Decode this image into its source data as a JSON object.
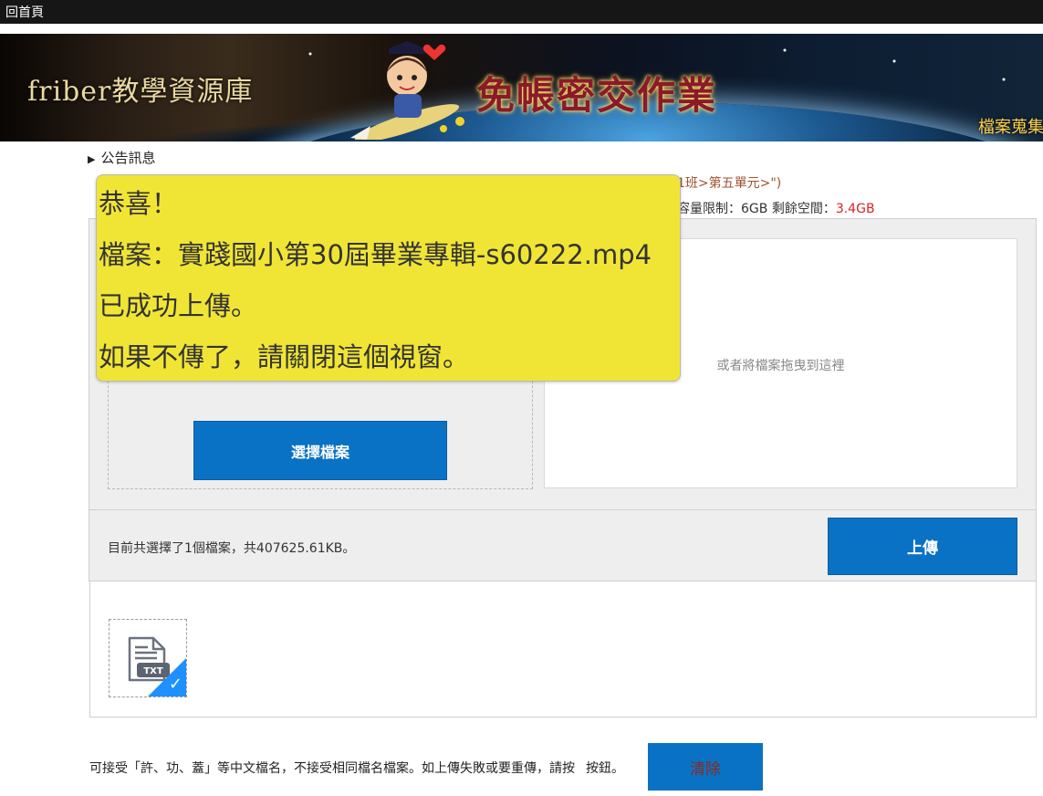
{
  "topbar": {
    "home_link": "回首頁"
  },
  "banner": {
    "site_title": "friber教學資源庫",
    "slogan": "免帳密交作業",
    "right_label": "檔案蒐集"
  },
  "announcement": {
    "label": "公告訊息"
  },
  "path_hint": "1班>第五單元>\")",
  "quota": {
    "label_prefix": "容量限制：",
    "limit": "6GB",
    "free_label": " 剩餘空間：",
    "free": "3.4GB"
  },
  "uploader": {
    "choose_button": "選擇檔案",
    "drop_hint": "或者將檔案拖曳到這裡",
    "status_text": "目前共選擇了1個檔案，共407625.61KB。",
    "upload_button": "上傳"
  },
  "file_list": {
    "items": [
      {
        "type_label": "TXT",
        "selected": true,
        "icon": "txt-file-icon"
      }
    ]
  },
  "note": {
    "text_before": "可接受「許、功、蓋」等中文檔名，不接受相同檔名檔案。如上傳失敗或要重傳，請按",
    "text_after": "按鈕。",
    "clear_button": "清除"
  },
  "popup": {
    "line1": "恭喜！",
    "line2": "檔案：實踐國小第30屆畢業專輯-s60222.mp4",
    "line3": "已成功上傳。",
    "line4": "如果不傳了，請關閉這個視窗。"
  },
  "colors": {
    "primary_button": "#0a72c4",
    "popup_bg": "#f0e535",
    "free_space": "#dd2222",
    "path_text": "#a0522d"
  }
}
